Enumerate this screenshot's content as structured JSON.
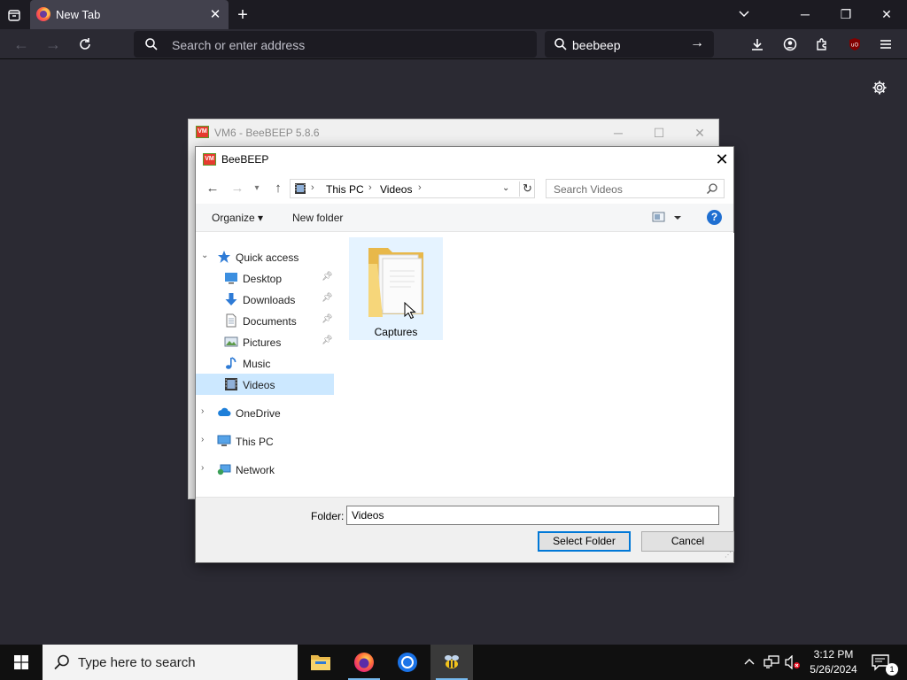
{
  "browser": {
    "tab_title": "New Tab",
    "url_placeholder": "Search or enter address",
    "search_value": "beebeep"
  },
  "bg_window": {
    "title": "VM6 - BeeBEEP 5.8.6",
    "icon_text": "VM"
  },
  "dialog": {
    "title": "BeeBEEP",
    "breadcrumb": [
      "This PC",
      "Videos"
    ],
    "search_placeholder": "Search Videos",
    "organize_label": "Organize",
    "new_folder_label": "New folder",
    "help_label": "?",
    "nav_items": [
      {
        "label": "Quick access"
      },
      {
        "label": "Desktop"
      },
      {
        "label": "Downloads"
      },
      {
        "label": "Documents"
      },
      {
        "label": "Pictures"
      },
      {
        "label": "Music"
      },
      {
        "label": "Videos"
      },
      {
        "label": "OneDrive"
      },
      {
        "label": "This PC"
      },
      {
        "label": "Network"
      }
    ],
    "selected_nav": "Videos",
    "folders": [
      {
        "label": "Captures"
      }
    ],
    "folder_field_label": "Folder:",
    "folder_field_value": "Videos",
    "select_button": "Select Folder",
    "cancel_button": "Cancel"
  },
  "taskbar": {
    "search_placeholder": "Type here to search",
    "time": "3:12 PM",
    "date": "5/26/2024",
    "notification_count": "1"
  },
  "colors": {
    "firefox_bg": "#2b2a33",
    "firefox_tabbar": "#1c1b22",
    "selection": "#cce8ff",
    "accent": "#0078d7",
    "taskbar": "#101010"
  }
}
